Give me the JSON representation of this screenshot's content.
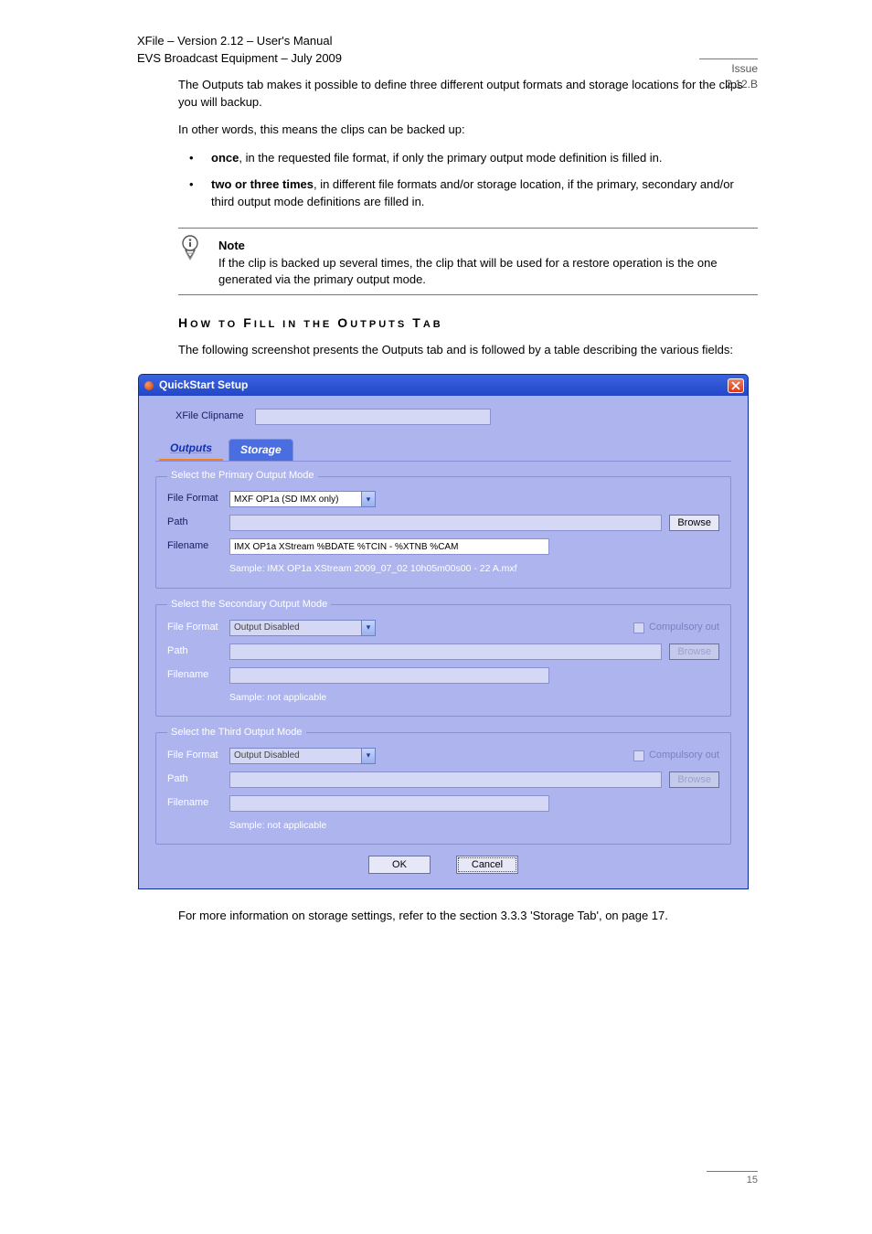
{
  "header": {
    "product": "XFile – Version 2.12 – User's Manual",
    "company": "EVS Broadcast Equipment – July 2009",
    "issue": "Issue 2.12.B"
  },
  "body": {
    "intro": [
      "The Outputs tab makes it possible to define three different output formats and storage locations for the clips you will backup.",
      "In other words, this means the clips can be backed up:"
    ],
    "bullets": [
      {
        "b": "once",
        "rest": ", in the requested file format, if only the primary output mode definition is filled in."
      },
      {
        "b": "two or three times",
        "rest": ", in different file formats and/or storage location, if the primary, secondary and/or third output mode definitions are filled in."
      }
    ],
    "note": "If the clip is backed up several times, the clip that will be used for a restore operation is the one generated via the primary output mode.",
    "section_heading": "HOW TO FILL IN THE OUTPUTS TAB",
    "afternote": "The following screenshot presents the Outputs tab and is followed by a table describing the various fields:",
    "xref": "For more information on storage settings, refer to the section 3.3.3 'Storage Tab', on page 17."
  },
  "dialog": {
    "title": "QuickStart Setup",
    "clipname_label": "XFile Clipname",
    "clipname_value": "",
    "tabs": {
      "outputs": "Outputs",
      "storage": "Storage"
    },
    "labels": {
      "file_format": "File Format",
      "path": "Path",
      "filename": "Filename",
      "browse": "Browse",
      "compulsory": "Compulsory out",
      "sample_prefix": "Sample:"
    },
    "primary": {
      "legend": "Select the Primary Output Mode",
      "format": "MXF OP1a (SD IMX only)",
      "path": "",
      "filename": "IMX OP1a XStream %BDATE %TCIN - %XTNB %CAM",
      "sample": "Sample:   IMX OP1a XStream 2009_07_02 10h05m00s00 - 22 A.mxf"
    },
    "secondary": {
      "legend": "Select the Secondary Output Mode",
      "format": "Output Disabled",
      "path": "",
      "filename": "",
      "sample": "Sample: not applicable"
    },
    "third": {
      "legend": "Select the Third Output Mode",
      "format": "Output Disabled",
      "path": "",
      "filename": "",
      "sample": "Sample: not applicable"
    },
    "buttons": {
      "ok": "OK",
      "cancel": "Cancel"
    }
  },
  "footer": {
    "page": "15"
  }
}
